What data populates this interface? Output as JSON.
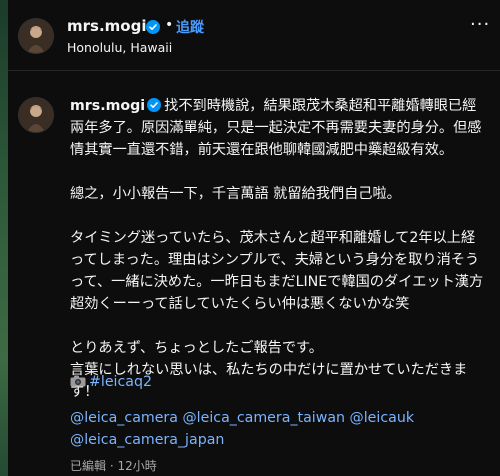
{
  "header": {
    "username": "mrs.mogi",
    "dot": "•",
    "follow_label": "追蹤",
    "location": "Honolulu, Hawaii",
    "more_label": "···"
  },
  "caption": {
    "username": "mrs.mogi",
    "body": "找不到時機說，結果跟茂木桑超和平離婚轉眼已經兩年多了。原因滿單純，只是一起決定不再需要夫妻的身分。但感情其實一直還不錯，前天還在跟他聊韓國減肥中藥超級有效。\n\n總之，小小報告一下，千言萬語 就留給我們自己啦。\n\nタイミング迷っていたら、茂木さんと超平和離婚して2年以上経ってしまった。理由はシンプルで、夫婦という身分を取り消そうって、一緒に決めた。一昨日もまだLINEで韓国のダイエット漢方超効くーーって話していたくらい仲は悪くないかな笑\n\nとりあえず、ちょっとしたご報告です。\n言葉にしれない思いは、私たちの中だけに置かせていただきます！",
    "hashtag": "#leicaq2",
    "mentions": [
      "@leica_camera",
      "@leica_camera_taiwan",
      "@leicauk",
      "@leica_camera_japan"
    ],
    "meta": "已編輯 · 12小時"
  },
  "icons": {
    "verified": "verified-badge-icon",
    "camera": "camera-icon",
    "more": "more-options-icon"
  },
  "colors": {
    "accent": "#4a9bff",
    "link": "#7ab3ff",
    "background": "#0d0d0d"
  }
}
